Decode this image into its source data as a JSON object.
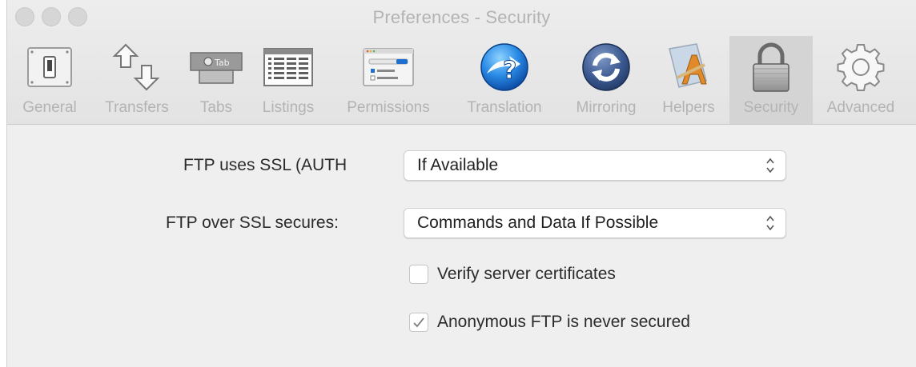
{
  "window": {
    "title": "Preferences - Security"
  },
  "toolbar": {
    "items": [
      {
        "label": "General",
        "icon": "switch-icon"
      },
      {
        "label": "Transfers",
        "icon": "transfer-arrows-icon"
      },
      {
        "label": "Tabs",
        "icon": "tab-icon",
        "badge": "Tab"
      },
      {
        "label": "Listings",
        "icon": "listing-icon"
      },
      {
        "label": "Permissions",
        "icon": "permissions-icon"
      },
      {
        "label": "Translation",
        "icon": "translation-icon"
      },
      {
        "label": "Mirroring",
        "icon": "mirroring-icon"
      },
      {
        "label": "Helpers",
        "icon": "helpers-icon"
      },
      {
        "label": "Security",
        "icon": "padlock-icon"
      },
      {
        "label": "Advanced",
        "icon": "gear-icon"
      }
    ],
    "selected": "Security"
  },
  "security": {
    "ssl_auth_label": "FTP uses SSL (AUTH",
    "ssl_auth_value": "If Available",
    "ssl_secures_label": "FTP over SSL secures:",
    "ssl_secures_value": "Commands and Data If Possible",
    "verify_label": "Verify server certificates",
    "verify_checked": false,
    "anonymous_label": "Anonymous FTP is never secured",
    "anonymous_checked": true
  },
  "colors": {
    "accent_blue": "#1f6fd1",
    "label_disabled": "#b3b3b3",
    "selected_tab_bg": "#d4d4d4"
  }
}
